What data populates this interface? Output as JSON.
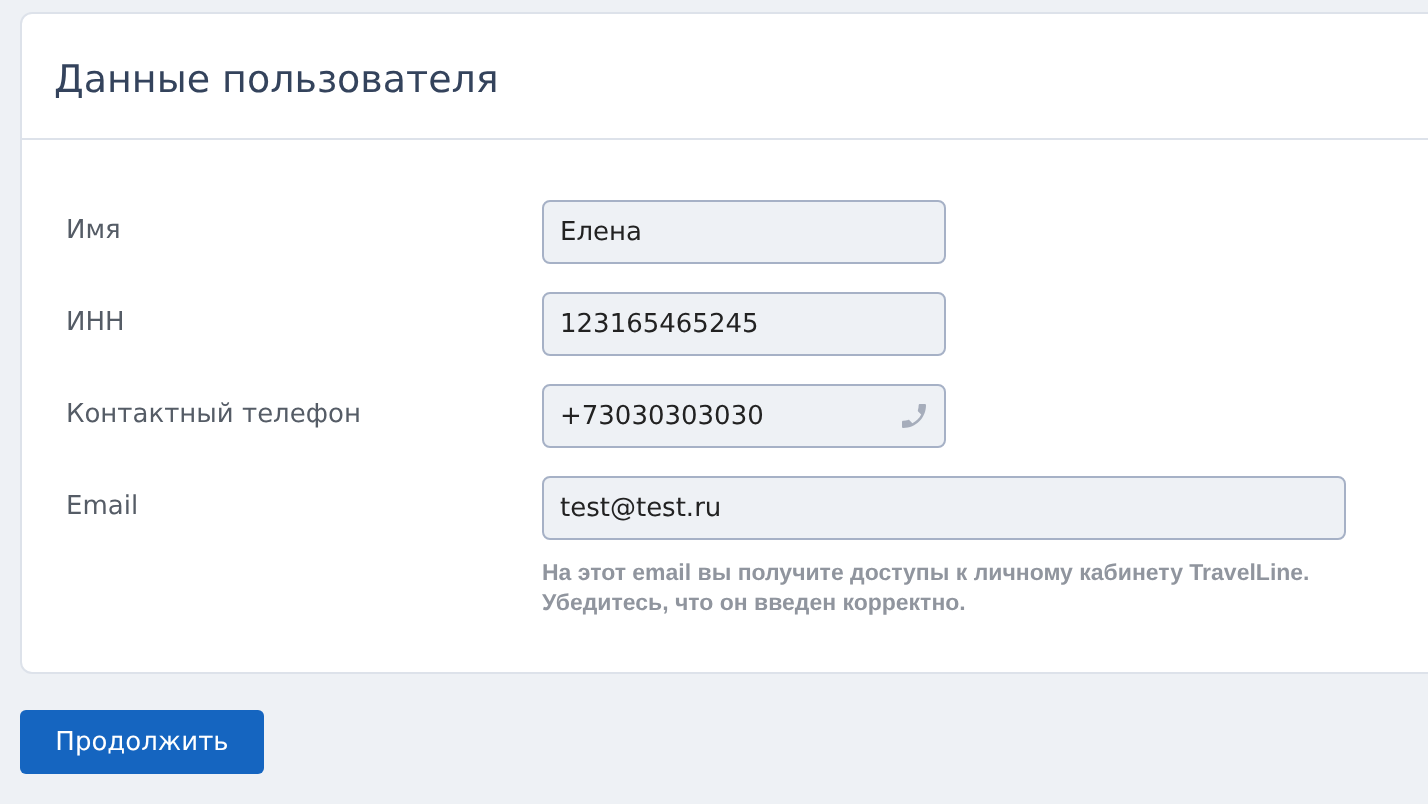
{
  "card": {
    "title": "Данные пользователя",
    "fields": [
      {
        "label": "Имя",
        "value": "Елена",
        "kind": "short"
      },
      {
        "label": "ИНН",
        "value": "123165465245",
        "kind": "short"
      },
      {
        "label": "Контактный телефон",
        "value": "+73030303030",
        "kind": "phone"
      },
      {
        "label": "Email",
        "value": "test@test.ru",
        "kind": "wide",
        "hint_lines": [
          "На этот email вы получите доступы к личному кабинету TravelLine.",
          "Убедитесь, что он введен корректно."
        ]
      }
    ]
  },
  "buttons": [
    "Продолжить"
  ]
}
